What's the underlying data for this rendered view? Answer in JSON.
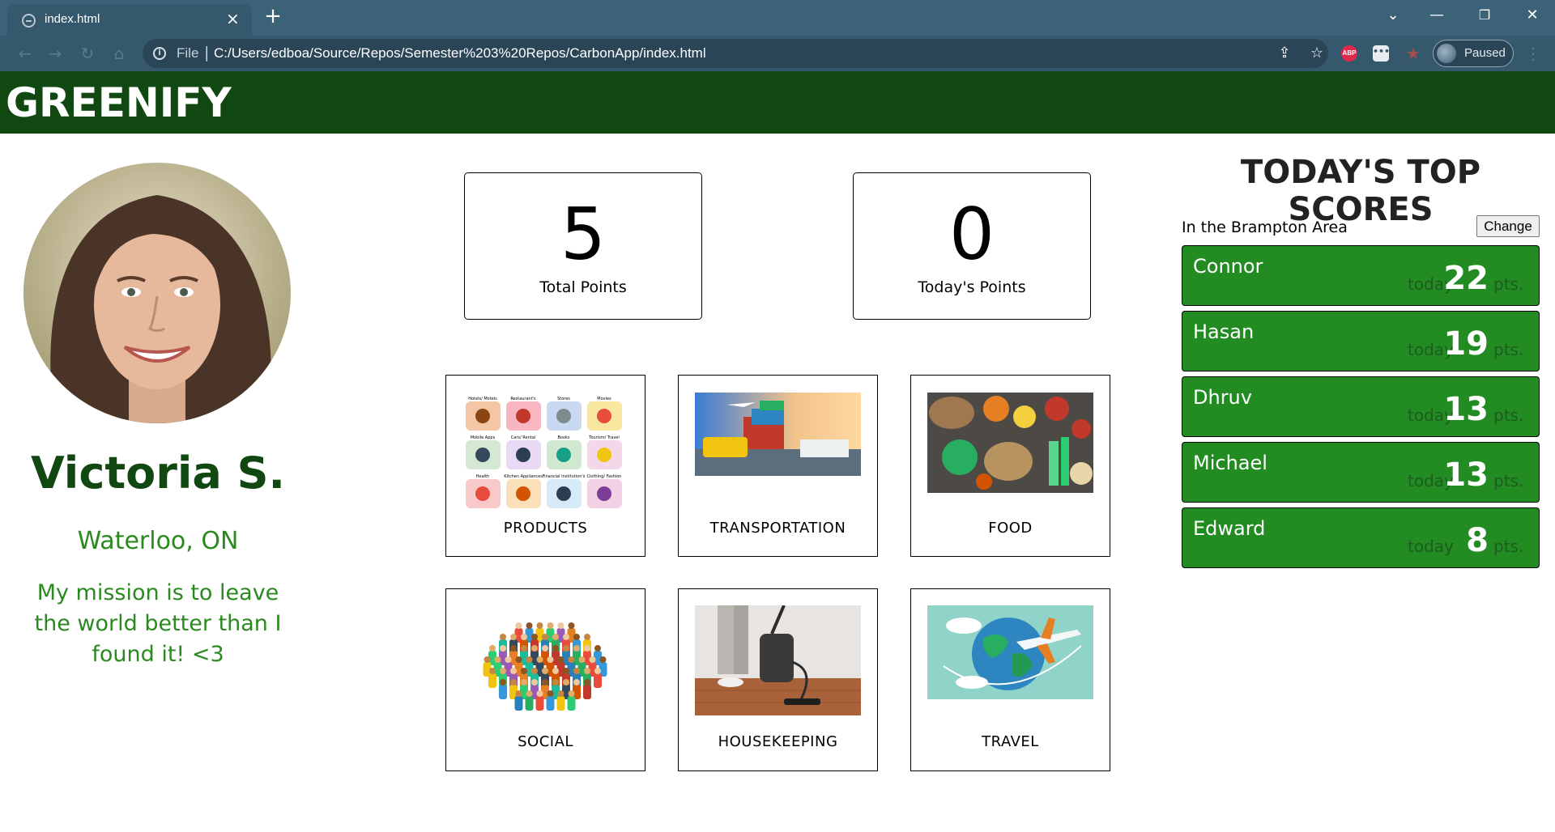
{
  "browser": {
    "tab_title": "index.html",
    "tab_close": "×",
    "new_tab": "+",
    "url_scheme_label": "File",
    "url_separator": "|",
    "url": "C:/Users/edboa/Source/Repos/Semester%203%20Repos/CarbonApp/index.html",
    "profile_status": "Paused",
    "extensions": [
      "ABP",
      "•••"
    ]
  },
  "app": {
    "brand": "GREENIFY"
  },
  "profile": {
    "name": "Victoria S.",
    "location": "Waterloo, ON",
    "mission": "My mission is to leave the world better than I found it! <3"
  },
  "points": {
    "total_value": "5",
    "total_label": "Total Points",
    "today_value": "0",
    "today_label": "Today's Points"
  },
  "categories": [
    {
      "label": "PRODUCTS"
    },
    {
      "label": "TRANSPORTATION"
    },
    {
      "label": "FOOD"
    },
    {
      "label": "SOCIAL"
    },
    {
      "label": "HOUSEKEEPING"
    },
    {
      "label": "TRAVEL"
    }
  ],
  "product_tiles": [
    "Hotels/ Motels",
    "Restaurant's",
    "Stores",
    "Movies",
    "Mobile Apps",
    "Cars/ Rental",
    "Books",
    "Tourism/ Travel",
    "Health",
    "Kitchen Appliances",
    "Financial Institution's",
    "Clothing/ Fashion"
  ],
  "leaderboard": {
    "title": "TODAY'S TOP SCORES",
    "area": "In the Brampton Area",
    "change_button": "Change",
    "today_word": "today",
    "pts_word": "pts.",
    "rows": [
      {
        "name": "Connor",
        "score": "22"
      },
      {
        "name": "Hasan",
        "score": "19"
      },
      {
        "name": "Dhruv",
        "score": "13"
      },
      {
        "name": "Michael",
        "score": "13"
      },
      {
        "name": "Edward",
        "score": "8"
      }
    ]
  },
  "colors": {
    "header_bg": "#114811",
    "name_color": "#114811",
    "accent_green": "#2b8a1f",
    "score_row_bg": "#228b22",
    "chrome_bg": "#3c6278"
  }
}
